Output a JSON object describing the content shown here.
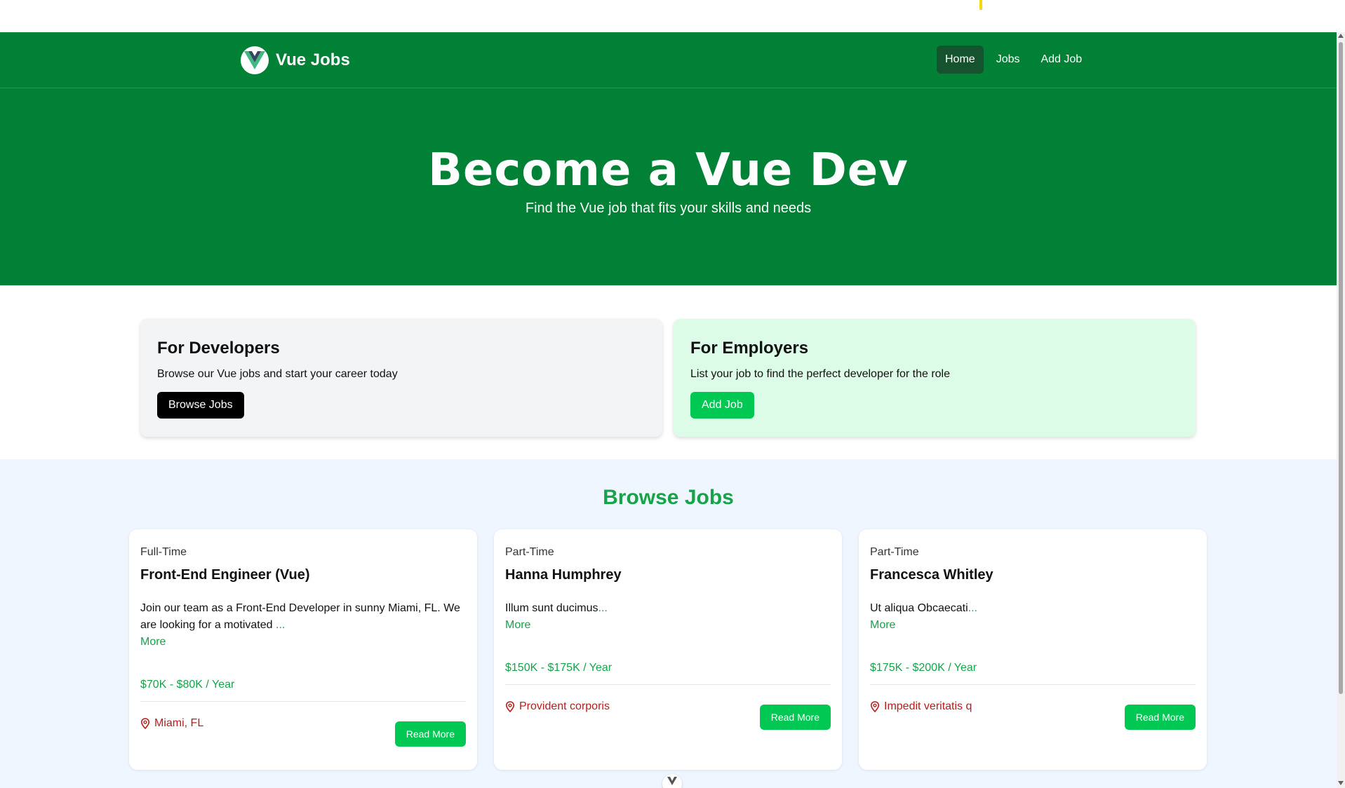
{
  "colors": {
    "primary_green": "#008135",
    "accent_green": "#00c853",
    "text_green": "#16a34a",
    "location_red": "#b91c1c",
    "browse_bg": "#eff6ff",
    "employer_bg": "#dcfce7",
    "developer_bg": "#f3f4f6"
  },
  "brand": {
    "name": "Vue Jobs",
    "logo_icon": "vue-logo-icon"
  },
  "nav": {
    "items": [
      {
        "label": "Home",
        "active": true
      },
      {
        "label": "Jobs",
        "active": false
      },
      {
        "label": "Add Job",
        "active": false
      }
    ]
  },
  "hero": {
    "title": "Become a Vue Dev",
    "subtitle": "Find the Vue job that fits your skills and needs"
  },
  "info_cards": {
    "developers": {
      "title": "For Developers",
      "text": "Browse our Vue jobs and start your career today",
      "button": "Browse Jobs"
    },
    "employers": {
      "title": "For Employers",
      "text": "List your job to find the perfect developer for the role",
      "button": "Add Job"
    }
  },
  "browse": {
    "title": "Browse Jobs",
    "jobs": [
      {
        "type": "Full-Time",
        "title": "Front-End Engineer (Vue)",
        "description": "Join our team as a Front-End Developer in sunny Miami, FL. We are looking for a motivated ",
        "ellipsis": "...",
        "more": "More",
        "salary": "$70K - $80K / Year",
        "location": "Miami, FL",
        "button": "Read More"
      },
      {
        "type": "Part-Time",
        "title": "Hanna Humphrey",
        "description": "Illum sunt ducimus",
        "ellipsis": "...",
        "more": "More",
        "salary": "$150K - $175K / Year",
        "location": "Provident corporis",
        "button": "Read More"
      },
      {
        "type": "Part-Time",
        "title": "Francesca Whitley",
        "description": "Ut aliqua Obcaecati",
        "ellipsis": "...",
        "more": "More",
        "salary": "$175K - $200K / Year",
        "location": "Impedit veritatis q",
        "button": "Read More"
      }
    ]
  }
}
